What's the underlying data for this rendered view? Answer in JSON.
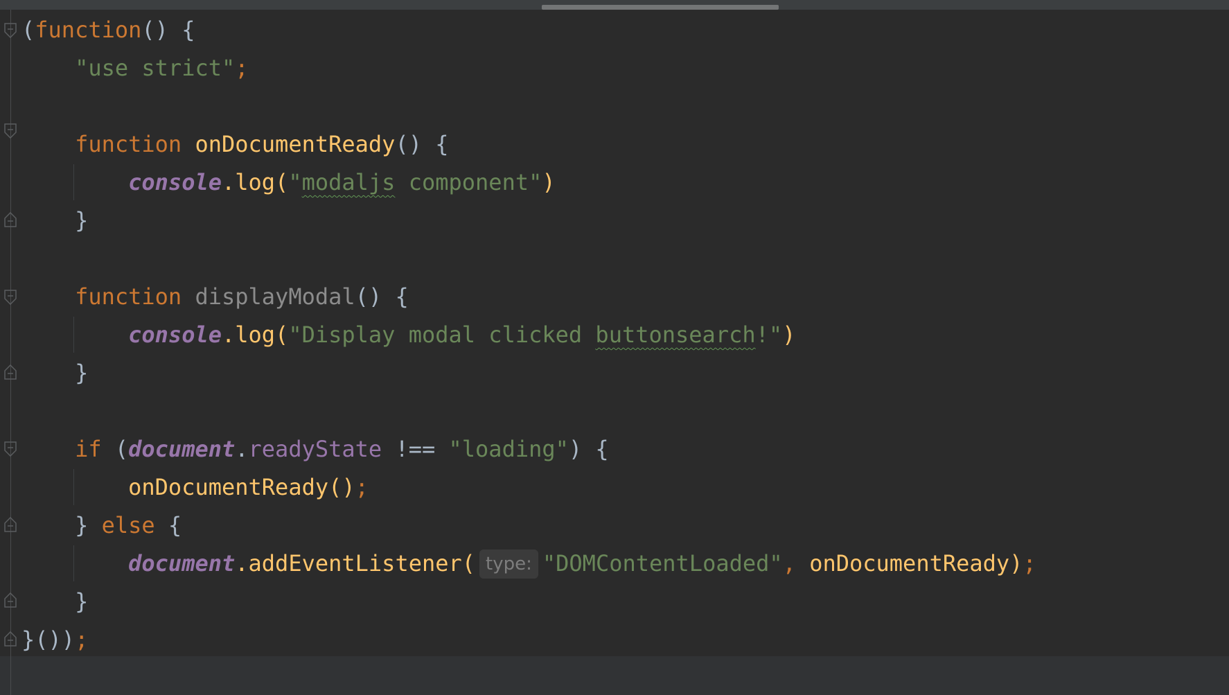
{
  "editor": {
    "language": "JavaScript",
    "colors": {
      "background": "#2b2b2b",
      "keyword": "#cc7832",
      "string": "#6a8759",
      "function": "#ffc66d",
      "global": "#9876aa",
      "text": "#a9b7c6",
      "unused": "#8c8c8c",
      "hint_bg": "#3b3b3b",
      "hint_fg": "#7d7d7d"
    },
    "icons": [
      "fold-open-icon",
      "fold-close-icon"
    ],
    "lines": [
      {
        "paren_open": "(",
        "kw_function": "function",
        "rest": "() {"
      },
      {
        "indent": "    ",
        "use_strict": "\"use strict\"",
        "semi": ";"
      },
      {},
      {
        "indent": "    ",
        "kw_function": "function",
        "name": "onDocumentReady",
        "rest": "() {"
      },
      {
        "indent": "        ",
        "obj": "console",
        "method": ".log(",
        "str_open": "\"",
        "typo_word": "modaljs",
        "str_rest": " component\"",
        "close": ")"
      },
      {
        "indent": "    ",
        "brace": "}"
      },
      {},
      {
        "indent": "    ",
        "kw_function": "function",
        "name": "displayModal",
        "rest": "() {"
      },
      {
        "indent": "        ",
        "obj": "console",
        "method": ".log(",
        "str_start": "\"Display modal clicked ",
        "typo_word": "buttonsearch",
        "str_end": "!\"",
        "close": ")"
      },
      {
        "indent": "    ",
        "brace": "}"
      },
      {},
      {
        "indent": "    ",
        "kw_if": "if",
        "open": " (",
        "obj": "document",
        "dot": ".",
        "prop": "readyState",
        "op": " !== ",
        "str": "\"loading\"",
        "rest": ") {"
      },
      {
        "indent": "        ",
        "call": "onDocumentReady",
        "parens": "()",
        "semi": ";"
      },
      {
        "indent": "    ",
        "brace": "} ",
        "kw_else": "else",
        "rest": " {"
      },
      {
        "indent": "        ",
        "obj": "document",
        "method": ".addEventListener(",
        "hint": "type:",
        "str": "\"DOMContentLoaded\"",
        "comma": ", ",
        "arg": "onDocumentReady",
        "close": ")",
        "semi": ";"
      },
      {
        "indent": "    ",
        "brace": "}"
      },
      {
        "end": "}())",
        "semi": ";"
      }
    ]
  }
}
